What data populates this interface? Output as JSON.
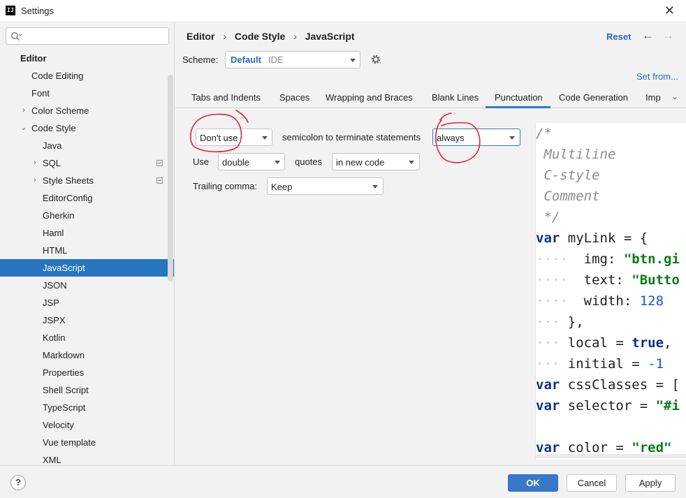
{
  "window": {
    "title": "Settings",
    "app_icon": "IJ",
    "close_glyph": "✕"
  },
  "search": {
    "placeholder": "",
    "value": ""
  },
  "sidebar": {
    "items": [
      {
        "label": "Editor",
        "level": 0,
        "bold": true
      },
      {
        "label": "Code Editing",
        "level": 1
      },
      {
        "label": "Font",
        "level": 1
      },
      {
        "label": "Color Scheme",
        "level": 1,
        "chevron": "›"
      },
      {
        "label": "Code Style",
        "level": 1,
        "chevron": "⌄"
      },
      {
        "label": "Java",
        "level": 2
      },
      {
        "label": "SQL",
        "level": 2,
        "chevron": "›",
        "badge": true
      },
      {
        "label": "Style Sheets",
        "level": 2,
        "chevron": "›",
        "badge": true
      },
      {
        "label": "EditorConfig",
        "level": 2
      },
      {
        "label": "Gherkin",
        "level": 2
      },
      {
        "label": "Haml",
        "level": 2
      },
      {
        "label": "HTML",
        "level": 2
      },
      {
        "label": "JavaScript",
        "level": 2,
        "selected": true
      },
      {
        "label": "JSON",
        "level": 2
      },
      {
        "label": "JSP",
        "level": 2
      },
      {
        "label": "JSPX",
        "level": 2
      },
      {
        "label": "Kotlin",
        "level": 2
      },
      {
        "label": "Markdown",
        "level": 2
      },
      {
        "label": "Properties",
        "level": 2
      },
      {
        "label": "Shell Script",
        "level": 2
      },
      {
        "label": "TypeScript",
        "level": 2
      },
      {
        "label": "Velocity",
        "level": 2
      },
      {
        "label": "Vue template",
        "level": 2
      },
      {
        "label": "XML",
        "level": 2
      }
    ]
  },
  "header": {
    "breadcrumb": [
      "Editor",
      "Code Style",
      "JavaScript"
    ],
    "breadcrumb_sep": "›",
    "reset_label": "Reset",
    "back_glyph": "←",
    "forward_glyph": "→"
  },
  "scheme": {
    "label": "Scheme:",
    "value": "Default",
    "sub": "IDE",
    "set_from_label": "Set from..."
  },
  "tabs": [
    {
      "label": "Tabs and Indents"
    },
    {
      "label": "Spaces"
    },
    {
      "label": "Wrapping and Braces"
    },
    {
      "label": "Blank Lines"
    },
    {
      "label": "Punctuation",
      "active": true
    },
    {
      "label": "Code Generation"
    },
    {
      "label": "Imp"
    }
  ],
  "tabs_more_glyph": "⌄",
  "punctuation": {
    "row1": {
      "select": "Don't use",
      "text": "semicolon to terminate statements",
      "select2": "always"
    },
    "row2": {
      "label": "Use",
      "select": "double",
      "text": "quotes",
      "select2": "in new code"
    },
    "row3": {
      "label": "Trailing comma:",
      "select": "Keep"
    }
  },
  "preview": {
    "lines": [
      [
        {
          "t": "/*",
          "c": "cm"
        }
      ],
      [
        {
          "t": " Multiline",
          "c": "cm"
        }
      ],
      [
        {
          "t": " C-style",
          "c": "cm"
        }
      ],
      [
        {
          "t": " Comment",
          "c": "cm"
        }
      ],
      [
        {
          "t": " */",
          "c": "cm"
        }
      ],
      [
        {
          "t": "var",
          "c": "kw"
        },
        {
          "t": " myLink = {"
        }
      ],
      [
        {
          "t": "····",
          "c": "dot"
        },
        {
          "t": "  img: "
        },
        {
          "t": "\"btn.gi",
          "c": "str"
        }
      ],
      [
        {
          "t": "····",
          "c": "dot"
        },
        {
          "t": "  text: "
        },
        {
          "t": "\"Butto",
          "c": "str"
        }
      ],
      [
        {
          "t": "····",
          "c": "dot"
        },
        {
          "t": "  width: "
        },
        {
          "t": "128",
          "c": "num"
        }
      ],
      [
        {
          "t": "···",
          "c": "dot"
        },
        {
          "t": " },"
        }
      ],
      [
        {
          "t": "···",
          "c": "dot"
        },
        {
          "t": " local = "
        },
        {
          "t": "true",
          "c": "kw"
        },
        {
          "t": ","
        }
      ],
      [
        {
          "t": "···",
          "c": "dot"
        },
        {
          "t": " initial = "
        },
        {
          "t": "-1",
          "c": "num"
        }
      ],
      [
        {
          "t": "var",
          "c": "kw"
        },
        {
          "t": " cssClasses = ["
        }
      ],
      [
        {
          "t": "var",
          "c": "kw"
        },
        {
          "t": " selector = "
        },
        {
          "t": "\"#i",
          "c": "str"
        }
      ],
      [
        {
          "t": ""
        }
      ],
      [
        {
          "t": "var",
          "c": "kw"
        },
        {
          "t": " color = "
        },
        {
          "t": "\"red\"",
          "c": "str"
        }
      ]
    ]
  },
  "footer": {
    "help": "?",
    "ok": "OK",
    "cancel": "Cancel",
    "apply": "Apply"
  },
  "colors": {
    "accent": "#3878c8",
    "selection": "#2675bf",
    "annotation": "#e8202a"
  }
}
